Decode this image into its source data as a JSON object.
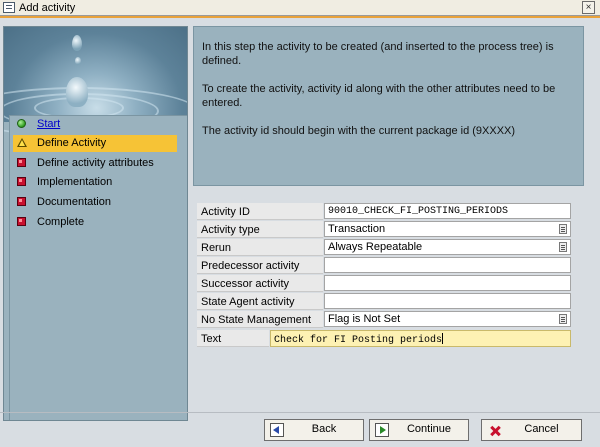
{
  "window": {
    "title": "Add activity",
    "close_glyph": "×"
  },
  "steps": [
    {
      "label": "Start",
      "status": "done",
      "icon": "green-circle-icon"
    },
    {
      "label": "Define Activity",
      "status": "current",
      "icon": "warning-triangle-icon"
    },
    {
      "label": "Define activity attributes",
      "status": "pending",
      "icon": "red-square-icon"
    },
    {
      "label": "Implementation",
      "status": "pending",
      "icon": "red-square-icon"
    },
    {
      "label": "Documentation",
      "status": "pending",
      "icon": "red-square-icon"
    },
    {
      "label": "Complete",
      "status": "pending",
      "icon": "red-square-icon"
    }
  ],
  "info": {
    "p1": "In this step the activity to be created (and inserted to the process tree) is defined.",
    "p2": "To create the activity, activity id along with the other attributes need to be entered.",
    "p3": "The activity id should begin with the current package id (9XXXX)"
  },
  "form": {
    "activity_id": {
      "label": "Activity ID",
      "value": "90010_CHECK_FI_POSTING_PERIODS"
    },
    "activity_type": {
      "label": "Activity type",
      "value": "Transaction"
    },
    "rerun": {
      "label": "Rerun",
      "value": "Always Repeatable"
    },
    "predecessor": {
      "label": "Predecessor activity",
      "value": ""
    },
    "successor": {
      "label": "Successor activity",
      "value": ""
    },
    "state_agent": {
      "label": "State Agent activity",
      "value": ""
    },
    "no_state_mgmt": {
      "label": "No State Management",
      "value": "Flag is Not Set"
    },
    "text": {
      "label": "Text",
      "value": "Check for FI Posting periods"
    }
  },
  "buttons": {
    "back": "Back",
    "continue": "Continue",
    "cancel": "Cancel"
  },
  "colors": {
    "accent_orange": "#e9a23a",
    "active_step": "#f6c336",
    "panel": "#9ab2be",
    "text_field": "#fdf1b3"
  }
}
